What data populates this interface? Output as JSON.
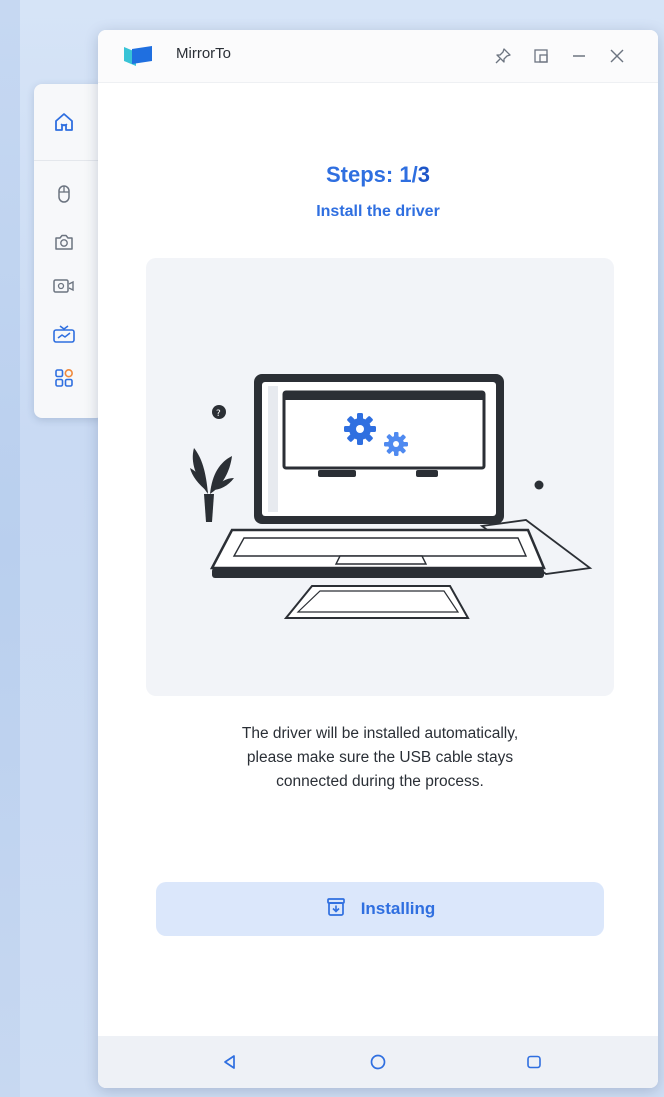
{
  "app": {
    "title": "MirrorTo",
    "brand_color": "#2f6fe0",
    "logo_color_dark": "#1f6fe0",
    "logo_color_accent": "#38c3d6"
  },
  "window_controls": {
    "icons": [
      "pin-icon",
      "restore-icon",
      "minimize-icon",
      "close-icon"
    ]
  },
  "side_toolbar": {
    "icons": [
      "home-icon",
      "mouse-icon",
      "camera-icon",
      "record-icon",
      "keyboard-icon",
      "apps-icon"
    ]
  },
  "steps": {
    "title_prefix": "Steps: ",
    "current": "1",
    "separator": "/",
    "total": "3",
    "subtitle": "Install the driver"
  },
  "description": {
    "line1": "The driver will be installed automatically,",
    "line2": "please make sure the USB cable stays",
    "line3": "connected during the process."
  },
  "install_button": {
    "label": "Installing",
    "icon": "download-box-icon",
    "bg_color": "#dbe7fb"
  },
  "android_nav": {
    "icons": [
      "back-triangle-icon",
      "home-circle-icon",
      "recents-square-icon"
    ]
  }
}
